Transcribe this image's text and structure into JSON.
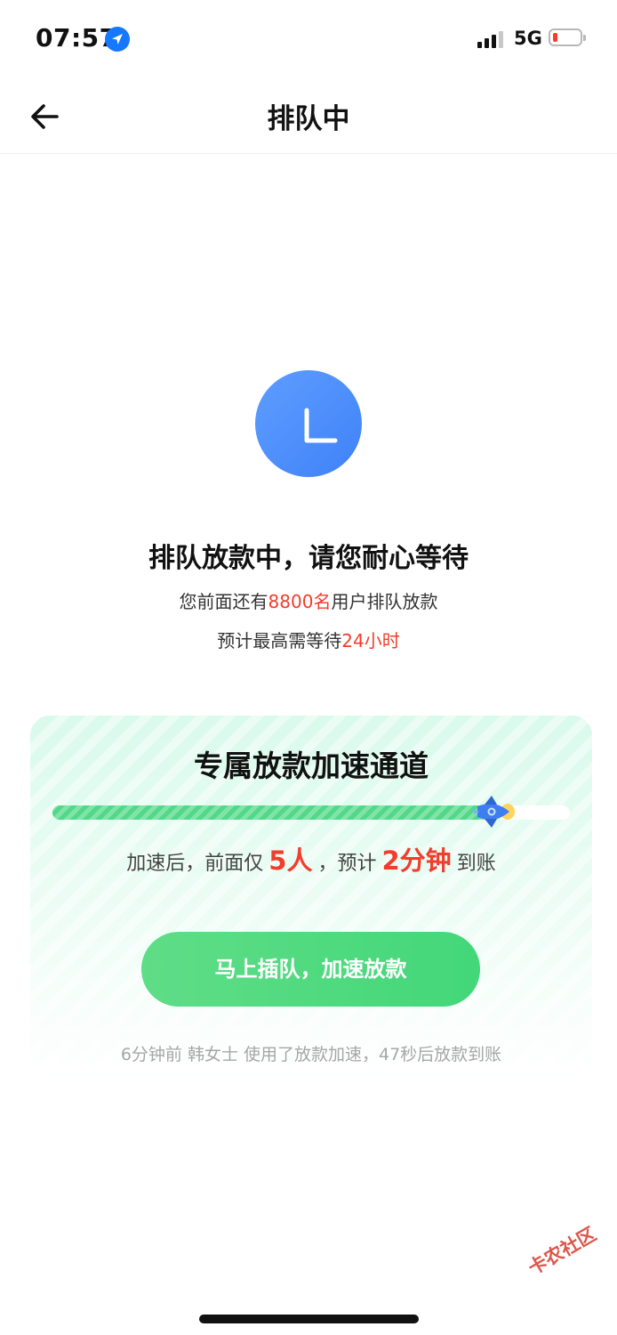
{
  "status_bar": {
    "time": "07:57",
    "network": "5G"
  },
  "nav": {
    "title": "排队中"
  },
  "queue": {
    "title": "排队放款中，请您耐心等待",
    "line1_prefix": "您前面还有",
    "line1_count": "8800名",
    "line1_suffix": "用户排队放款",
    "line2_prefix": "预计最高需等待",
    "line2_value": "24小时"
  },
  "boost_card": {
    "title": "专属放款加速通道",
    "progress": 0.87,
    "desc_prefix": "加速后，前面仅",
    "desc_count": "5人",
    "desc_mid": "，预计",
    "desc_time": "2分钟",
    "desc_suffix": "到账",
    "button_label": "马上插队，加速放款",
    "footer": "6分钟前 韩女士 使用了放款加速，47秒后放款到账"
  },
  "watermark": "卡农社区",
  "colors": {
    "accent_red": "#f23d2c",
    "green": "#52d888",
    "blue": "#3f82f8"
  }
}
